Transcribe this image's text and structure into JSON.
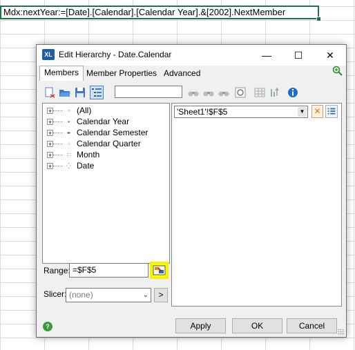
{
  "formula_bar": {
    "text": "Mdx:nextYear:=[Date].[Calendar].[Calendar Year].&[2002].NextMember"
  },
  "dialog": {
    "app_icon_text": "XL",
    "title": "Edit Hierarchy - Date.Calendar",
    "window_controls": {
      "minimize": "—",
      "maximize": "☐",
      "close": "✕"
    },
    "tabs": [
      {
        "label": "Members",
        "active": true
      },
      {
        "label": "Member Properties",
        "active": false
      },
      {
        "label": "Advanced",
        "active": false
      }
    ],
    "tree": [
      {
        "label": "(All)",
        "level_icon": "▫"
      },
      {
        "label": "Calendar Year",
        "level_icon": "▪"
      },
      {
        "label": "Calendar Semester",
        "level_icon": "▪▪"
      },
      {
        "label": "Calendar Quarter",
        "level_icon": "⁖"
      },
      {
        "label": "Month",
        "level_icon": "∷"
      },
      {
        "label": "Date",
        "level_icon": "⁛"
      }
    ],
    "range": {
      "label": "Range:",
      "value": "=$F$5"
    },
    "slicer": {
      "label": "Slicer:",
      "value": "(none)",
      "go": ">"
    },
    "right_combo": {
      "value": "'Sheet1'!$F$5"
    },
    "remove_button": "✕",
    "buttons": {
      "apply": "Apply",
      "ok": "OK",
      "cancel": "Cancel"
    },
    "help_icon_text": "?"
  },
  "colors": {
    "excel_green": "#217346",
    "highlight": "#ffff00",
    "accent_orange": "#e07800"
  }
}
